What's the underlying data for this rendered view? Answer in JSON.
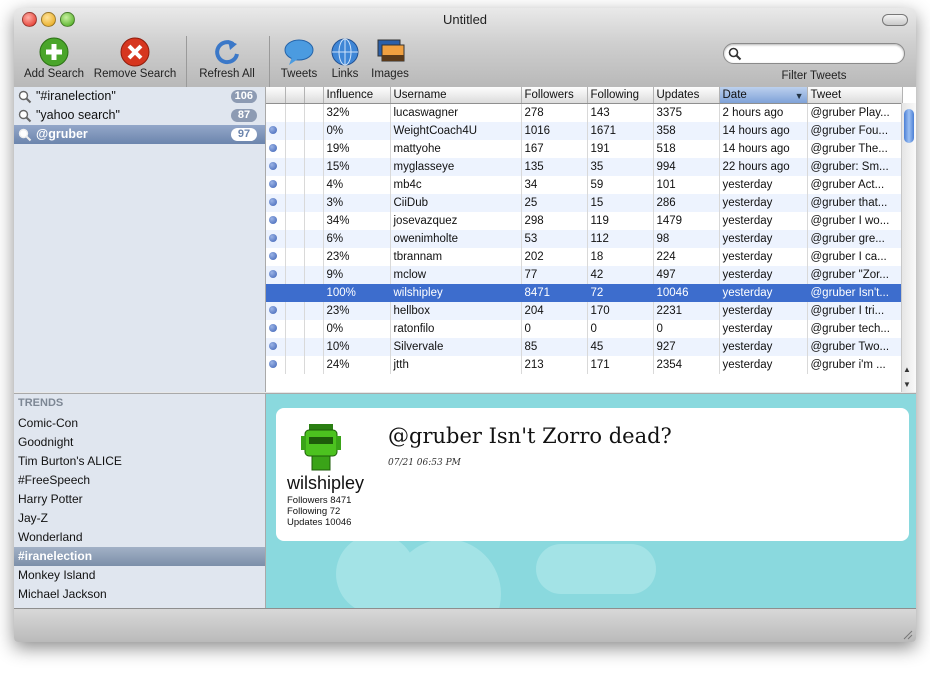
{
  "window": {
    "title": "Untitled"
  },
  "toolbar": {
    "add_search": "Add Search",
    "remove_search": "Remove Search",
    "refresh_all": "Refresh All",
    "tweets": "Tweets",
    "links": "Links",
    "images": "Images",
    "filter_label": "Filter Tweets",
    "filter_value": ""
  },
  "searches": [
    {
      "label": "\"#iranelection\"",
      "count": "106"
    },
    {
      "label": "\"yahoo search\"",
      "count": "87"
    },
    {
      "label": "@gruber",
      "count": "97",
      "selected": true
    }
  ],
  "table": {
    "columns": [
      "",
      "",
      "",
      "Influence",
      "Username",
      "Followers",
      "Following",
      "Updates",
      "Date",
      "Tweet"
    ],
    "sorted_column": "Date",
    "rows": [
      {
        "dot": false,
        "influence": "32%",
        "username": "lucaswagner",
        "followers": "278",
        "following": "143",
        "updates": "3375",
        "date": "2 hours ago",
        "tweet": "@gruber Play..."
      },
      {
        "dot": true,
        "influence": "0%",
        "username": "WeightCoach4U",
        "followers": "1016",
        "following": "1671",
        "updates": "358",
        "date": "14 hours ago",
        "tweet": "@gruber Fou..."
      },
      {
        "dot": true,
        "influence": "19%",
        "username": "mattyohe",
        "followers": "167",
        "following": "191",
        "updates": "518",
        "date": "14 hours ago",
        "tweet": "@gruber The..."
      },
      {
        "dot": true,
        "influence": "15%",
        "username": "myglasseye",
        "followers": "135",
        "following": "35",
        "updates": "994",
        "date": "22 hours ago",
        "tweet": "@gruber: Sm..."
      },
      {
        "dot": true,
        "influence": "4%",
        "username": "mb4c",
        "followers": "34",
        "following": "59",
        "updates": "101",
        "date": "yesterday",
        "tweet": "@gruber Act..."
      },
      {
        "dot": true,
        "influence": "3%",
        "username": "CiiDub",
        "followers": "25",
        "following": "15",
        "updates": "286",
        "date": "yesterday",
        "tweet": "@gruber that..."
      },
      {
        "dot": true,
        "influence": "34%",
        "username": "josevazquez",
        "followers": "298",
        "following": "119",
        "updates": "1479",
        "date": "yesterday",
        "tweet": "@gruber I wo..."
      },
      {
        "dot": true,
        "influence": "6%",
        "username": "owenimholte",
        "followers": "53",
        "following": "112",
        "updates": "98",
        "date": "yesterday",
        "tweet": "@gruber gre..."
      },
      {
        "dot": true,
        "influence": "23%",
        "username": "tbrannam",
        "followers": "202",
        "following": "18",
        "updates": "224",
        "date": "yesterday",
        "tweet": "@gruber I ca..."
      },
      {
        "dot": true,
        "influence": "9%",
        "username": "mclow",
        "followers": "77",
        "following": "42",
        "updates": "497",
        "date": "yesterday",
        "tweet": "@gruber \"Zor..."
      },
      {
        "dot": false,
        "influence": "100%",
        "username": "wilshipley",
        "followers": "8471",
        "following": "72",
        "updates": "10046",
        "date": "yesterday",
        "tweet": "@gruber Isn't...",
        "selected": true
      },
      {
        "dot": true,
        "influence": "23%",
        "username": "hellbox",
        "followers": "204",
        "following": "170",
        "updates": "2231",
        "date": "yesterday",
        "tweet": "@gruber I tri..."
      },
      {
        "dot": true,
        "influence": "0%",
        "username": "ratonfilo",
        "followers": "0",
        "following": "0",
        "updates": "0",
        "date": "yesterday",
        "tweet": "@gruber tech..."
      },
      {
        "dot": true,
        "influence": "10%",
        "username": "Silvervale",
        "followers": "85",
        "following": "45",
        "updates": "927",
        "date": "yesterday",
        "tweet": "@gruber Two..."
      },
      {
        "dot": true,
        "influence": "24%",
        "username": "jtth",
        "followers": "213",
        "following": "171",
        "updates": "2354",
        "date": "yesterday",
        "tweet": "@gruber i'm ..."
      }
    ]
  },
  "trends": {
    "heading": "TRENDS",
    "items": [
      {
        "label": "Comic-Con"
      },
      {
        "label": "Goodnight"
      },
      {
        "label": "Tim Burton's ALICE"
      },
      {
        "label": "#FreeSpeech"
      },
      {
        "label": "Harry Potter"
      },
      {
        "label": "Jay-Z"
      },
      {
        "label": "Wonderland"
      },
      {
        "label": "#iranelection",
        "selected": true
      },
      {
        "label": "Monkey Island"
      },
      {
        "label": "Michael Jackson"
      }
    ]
  },
  "detail": {
    "tweet": "@gruber Isn't Zorro dead?",
    "timestamp": "07/21 06:53 PM",
    "username": "wilshipley",
    "followers": "Followers  8471",
    "following": "Following  72",
    "updates": "Updates  10046"
  },
  "colors": {
    "selection": "#3d6dcd",
    "detail_bg": "#8ad9de"
  }
}
